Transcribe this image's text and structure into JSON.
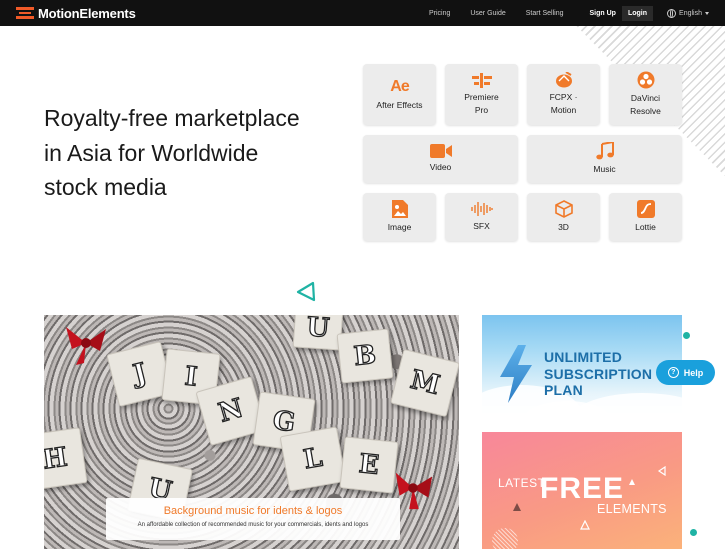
{
  "header": {
    "brand": "MotionElements",
    "nav": {
      "pricing": "Pricing",
      "user_guide": "User Guide",
      "start_selling": "Start Selling",
      "sign_up": "Sign Up",
      "login": "Login",
      "language": "English"
    }
  },
  "hero": {
    "headline_line1": "Royalty-free marketplace",
    "headline_line2": "in Asia for Worldwide",
    "headline_line3": "stock media"
  },
  "categories": {
    "after_effects": {
      "label": "After Effects",
      "icon": "after-effects-icon"
    },
    "premiere": {
      "label_line1": "Premiere",
      "label_line2": "Pro",
      "icon": "premiere-pro-icon"
    },
    "fcpx": {
      "label_line1": "FCPX ·",
      "label_line2": "Motion",
      "icon": "fcpx-icon"
    },
    "davinci": {
      "label_line1": "DaVinci",
      "label_line2": "Resolve",
      "icon": "davinci-resolve-icon"
    },
    "video": {
      "label": "Video",
      "icon": "video-camera-icon"
    },
    "music": {
      "label": "Music",
      "icon": "music-note-icon"
    },
    "image": {
      "label": "Image",
      "icon": "image-icon"
    },
    "sfx": {
      "label": "SFX",
      "icon": "sound-wave-icon"
    },
    "three_d": {
      "label": "3D",
      "icon": "cube-icon"
    },
    "lottie": {
      "label": "Lottie",
      "icon": "lottie-icon"
    }
  },
  "jingle_banner": {
    "title": "Background music for idents & logos",
    "subtitle": "An affordable collection of recommended music for your commercials, idents and logos",
    "letters": [
      "U",
      "B",
      "J",
      "I",
      "N",
      "G",
      "L",
      "E",
      "M",
      "H",
      "U"
    ]
  },
  "subscription_banner": {
    "line1": "UNLIMITED",
    "line2": "SUBSCRIPTION",
    "line3": "PLAN"
  },
  "free_banner": {
    "latest": "LATEST",
    "free": "FREE",
    "elements": "ELEMENTS"
  },
  "help": {
    "label": "Help"
  },
  "colors": {
    "accent": "#f07a2a",
    "topbar": "#111111",
    "teal": "#1fb3a4",
    "help_blue": "#1aa0dc",
    "subscription_text": "#1d6fa8"
  }
}
